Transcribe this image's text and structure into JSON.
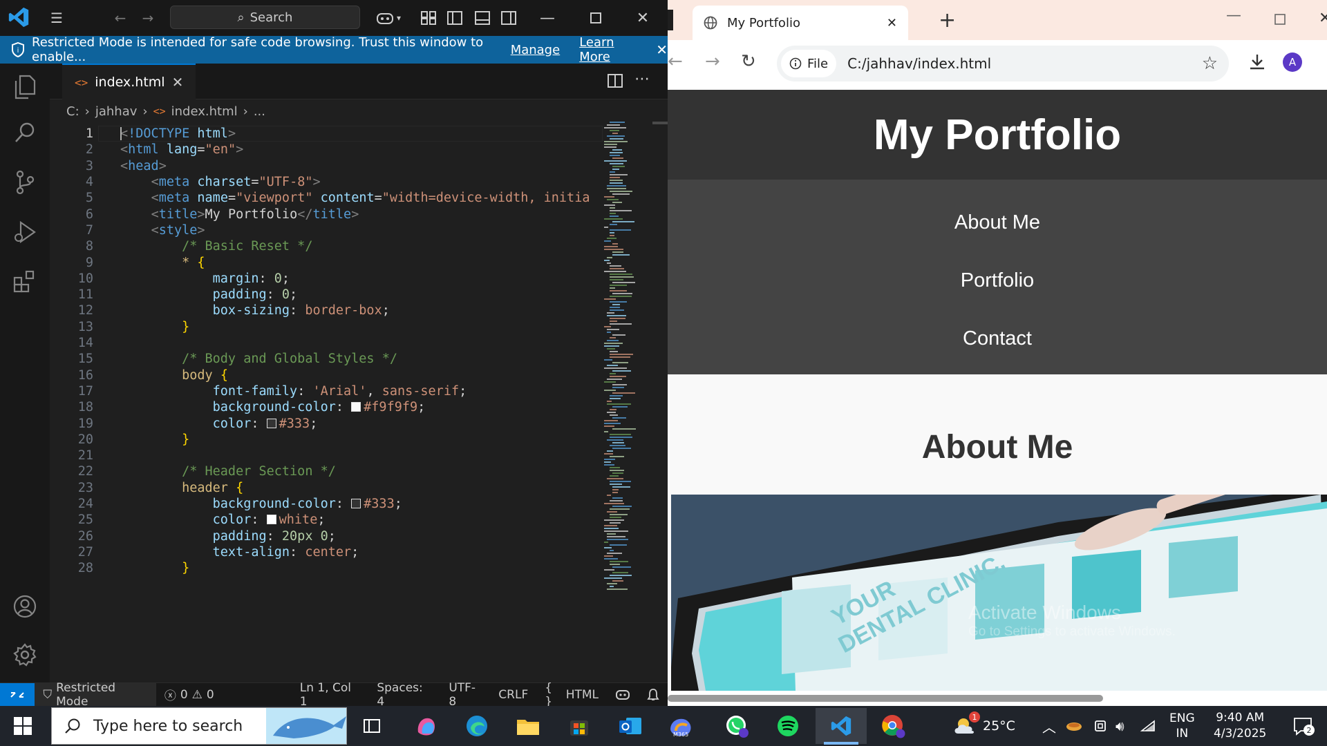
{
  "vscode": {
    "search_label": "Search",
    "banner": {
      "message": "Restricted Mode is intended for safe code browsing. Trust this window to enable...",
      "manage": "Manage",
      "learn_more": "Learn More"
    },
    "tab_label": "index.html",
    "breadcrumb": [
      "C:",
      "jahhav",
      "index.html",
      "..."
    ],
    "lines": [
      [
        [
          "t-br",
          "<"
        ],
        [
          "t-tag",
          "!DOCTYPE"
        ],
        [
          "t-txt",
          " "
        ],
        [
          "t-attr",
          "html"
        ],
        [
          "t-br",
          ">"
        ]
      ],
      [
        [
          "t-br",
          "<"
        ],
        [
          "t-tag",
          "html"
        ],
        [
          "t-txt",
          " "
        ],
        [
          "t-attr",
          "lang"
        ],
        [
          "t-txt",
          "="
        ],
        [
          "t-str",
          "\"en\""
        ],
        [
          "t-br",
          ">"
        ]
      ],
      [
        [
          "t-br",
          "<"
        ],
        [
          "t-tag",
          "head"
        ],
        [
          "t-br",
          ">"
        ]
      ],
      [
        [
          "t-txt",
          "    "
        ],
        [
          "t-br",
          "<"
        ],
        [
          "t-tag",
          "meta"
        ],
        [
          "t-txt",
          " "
        ],
        [
          "t-attr",
          "charset"
        ],
        [
          "t-txt",
          "="
        ],
        [
          "t-str",
          "\"UTF-8\""
        ],
        [
          "t-br",
          ">"
        ]
      ],
      [
        [
          "t-txt",
          "    "
        ],
        [
          "t-br",
          "<"
        ],
        [
          "t-tag",
          "meta"
        ],
        [
          "t-txt",
          " "
        ],
        [
          "t-attr",
          "name"
        ],
        [
          "t-txt",
          "="
        ],
        [
          "t-str",
          "\"viewport\""
        ],
        [
          "t-txt",
          " "
        ],
        [
          "t-attr",
          "content"
        ],
        [
          "t-txt",
          "="
        ],
        [
          "t-str",
          "\"width=device-width, initia"
        ]
      ],
      [
        [
          "t-txt",
          "    "
        ],
        [
          "t-br",
          "<"
        ],
        [
          "t-tag",
          "title"
        ],
        [
          "t-br",
          ">"
        ],
        [
          "t-txt",
          "My Portfolio"
        ],
        [
          "t-br",
          "</"
        ],
        [
          "t-tag",
          "title"
        ],
        [
          "t-br",
          ">"
        ]
      ],
      [
        [
          "t-txt",
          "    "
        ],
        [
          "t-br",
          "<"
        ],
        [
          "t-tag",
          "style"
        ],
        [
          "t-br",
          ">"
        ]
      ],
      [
        [
          "t-txt",
          "        "
        ],
        [
          "t-cmt",
          "/* Basic Reset */"
        ]
      ],
      [
        [
          "t-txt",
          "        "
        ],
        [
          "t-sel",
          "*"
        ],
        [
          "t-txt",
          " "
        ],
        [
          "t-curly",
          "{"
        ]
      ],
      [
        [
          "t-txt",
          "            "
        ],
        [
          "t-prop",
          "margin"
        ],
        [
          "t-txt",
          ": "
        ],
        [
          "t-num",
          "0"
        ],
        [
          "t-txt",
          ";"
        ]
      ],
      [
        [
          "t-txt",
          "            "
        ],
        [
          "t-prop",
          "padding"
        ],
        [
          "t-txt",
          ": "
        ],
        [
          "t-num",
          "0"
        ],
        [
          "t-txt",
          ";"
        ]
      ],
      [
        [
          "t-txt",
          "            "
        ],
        [
          "t-prop",
          "box-sizing"
        ],
        [
          "t-txt",
          ": "
        ],
        [
          "t-kw",
          "border-box"
        ],
        [
          "t-txt",
          ";"
        ]
      ],
      [
        [
          "t-txt",
          "        "
        ],
        [
          "t-curly",
          "}"
        ]
      ],
      [],
      [
        [
          "t-txt",
          "        "
        ],
        [
          "t-cmt",
          "/* Body and Global Styles */"
        ]
      ],
      [
        [
          "t-txt",
          "        "
        ],
        [
          "t-sel",
          "body"
        ],
        [
          "t-txt",
          " "
        ],
        [
          "t-curly",
          "{"
        ]
      ],
      [
        [
          "t-txt",
          "            "
        ],
        [
          "t-prop",
          "font-family"
        ],
        [
          "t-txt",
          ": "
        ],
        [
          "t-str",
          "'Arial'"
        ],
        [
          "t-txt",
          ", "
        ],
        [
          "t-kw",
          "sans-serif"
        ],
        [
          "t-txt",
          ";"
        ]
      ],
      [
        [
          "t-txt",
          "            "
        ],
        [
          "t-prop",
          "background-color"
        ],
        [
          "t-txt",
          ": "
        ],
        [
          "sw",
          "#f9f9f9"
        ],
        [
          "t-kw",
          "#f9f9f9"
        ],
        [
          "t-txt",
          ";"
        ]
      ],
      [
        [
          "t-txt",
          "            "
        ],
        [
          "t-prop",
          "color"
        ],
        [
          "t-txt",
          ": "
        ],
        [
          "sw",
          "#333"
        ],
        [
          "t-kw",
          "#333"
        ],
        [
          "t-txt",
          ";"
        ]
      ],
      [
        [
          "t-txt",
          "        "
        ],
        [
          "t-curly",
          "}"
        ]
      ],
      [],
      [
        [
          "t-txt",
          "        "
        ],
        [
          "t-cmt",
          "/* Header Section */"
        ]
      ],
      [
        [
          "t-txt",
          "        "
        ],
        [
          "t-sel",
          "header"
        ],
        [
          "t-txt",
          " "
        ],
        [
          "t-curly",
          "{"
        ]
      ],
      [
        [
          "t-txt",
          "            "
        ],
        [
          "t-prop",
          "background-color"
        ],
        [
          "t-txt",
          ": "
        ],
        [
          "sw",
          "#333"
        ],
        [
          "t-kw",
          "#333"
        ],
        [
          "t-txt",
          ";"
        ]
      ],
      [
        [
          "t-txt",
          "            "
        ],
        [
          "t-prop",
          "color"
        ],
        [
          "t-txt",
          ": "
        ],
        [
          "sw",
          "#ffffff"
        ],
        [
          "t-kw",
          "white"
        ],
        [
          "t-txt",
          ";"
        ]
      ],
      [
        [
          "t-txt",
          "            "
        ],
        [
          "t-prop",
          "padding"
        ],
        [
          "t-txt",
          ": "
        ],
        [
          "t-num",
          "20px"
        ],
        [
          "t-txt",
          " "
        ],
        [
          "t-num",
          "0"
        ],
        [
          "t-txt",
          ";"
        ]
      ],
      [
        [
          "t-txt",
          "            "
        ],
        [
          "t-prop",
          "text-align"
        ],
        [
          "t-txt",
          ": "
        ],
        [
          "t-kw",
          "center"
        ],
        [
          "t-txt",
          ";"
        ]
      ],
      [
        [
          "t-txt",
          "        "
        ],
        [
          "t-curly",
          "}"
        ]
      ]
    ],
    "status": {
      "mode": "Restricted Mode",
      "errors": "0",
      "warnings": "0",
      "position": "Ln 1, Col 1",
      "spaces": "Spaces: 4",
      "encoding": "UTF-8",
      "eol": "CRLF",
      "language": "HTML"
    }
  },
  "browser": {
    "tab_title": "My Portfolio",
    "scheme_chip": "File",
    "url": "C:/jahhav/index.html",
    "profile_initial": "A",
    "site": {
      "title": "My Portfolio",
      "nav": [
        "About Me",
        "Portfolio",
        "Contact"
      ],
      "section_heading": "About Me"
    },
    "watermark": {
      "title": "Activate Windows",
      "subtitle": "Go to Settings to activate Windows."
    }
  },
  "taskbar": {
    "search_placeholder": "Type here to search",
    "weather_temp": "25°C",
    "weather_badge": "1",
    "lang_top": "ENG",
    "lang_bottom": "IN",
    "time": "9:40 AM",
    "date": "4/3/2025",
    "notif_count": "2"
  },
  "colors": {
    "accent": "#0078d4",
    "banner": "#0e639c",
    "site_header": "#333333",
    "site_nav": "#444444"
  }
}
